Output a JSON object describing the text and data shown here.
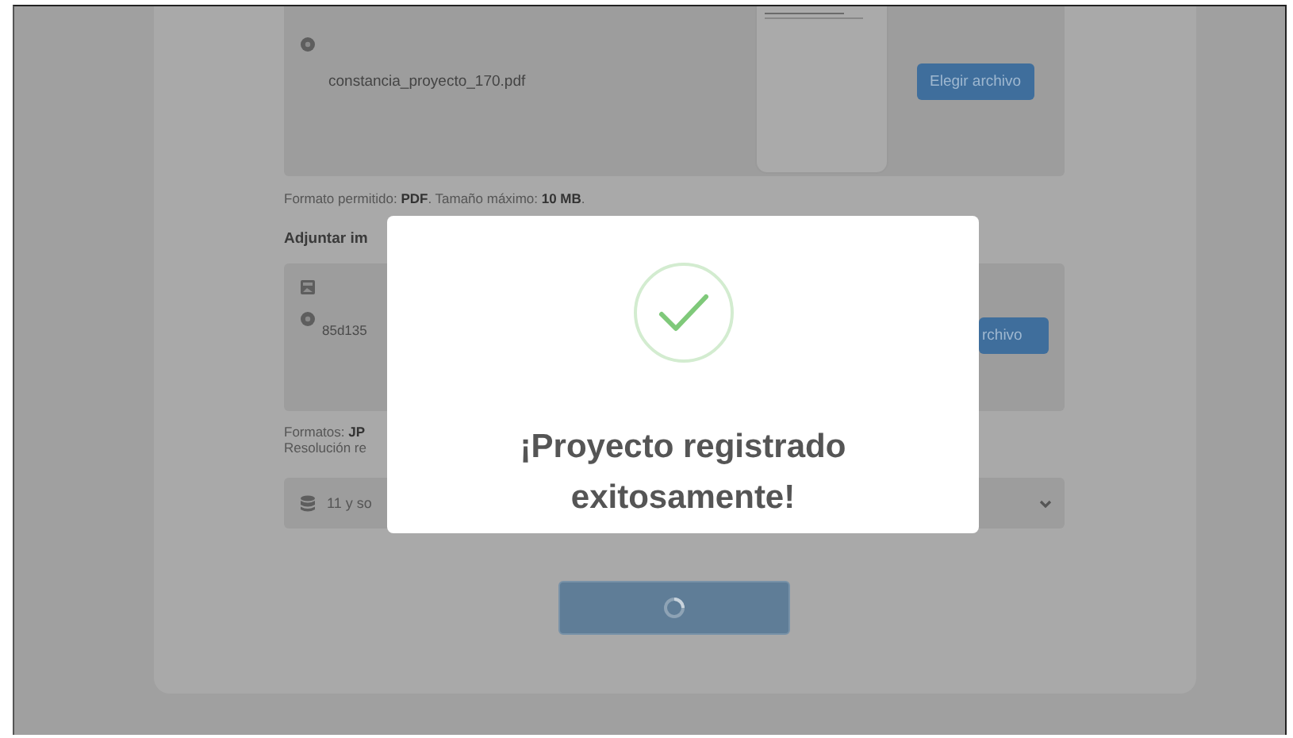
{
  "upload_pdf": {
    "filename": "constancia_proyecto_170.pdf",
    "button": "Elegir archivo",
    "hint": "Formato permitido: **PDF**. Tamaño máximo: **10 MB**."
  },
  "upload_image": {
    "label": "Adjuntar im",
    "filename": "85d135",
    "button": "rchivo",
    "hints": [
      "Formatos: **JP**",
      "Resolución re"
    ]
  },
  "select": {
    "value": "11 y so"
  },
  "submit": {
    "loading": true
  },
  "modal": {
    "kind": "success",
    "title": "¡Proyecto registrado exitosamente!"
  }
}
